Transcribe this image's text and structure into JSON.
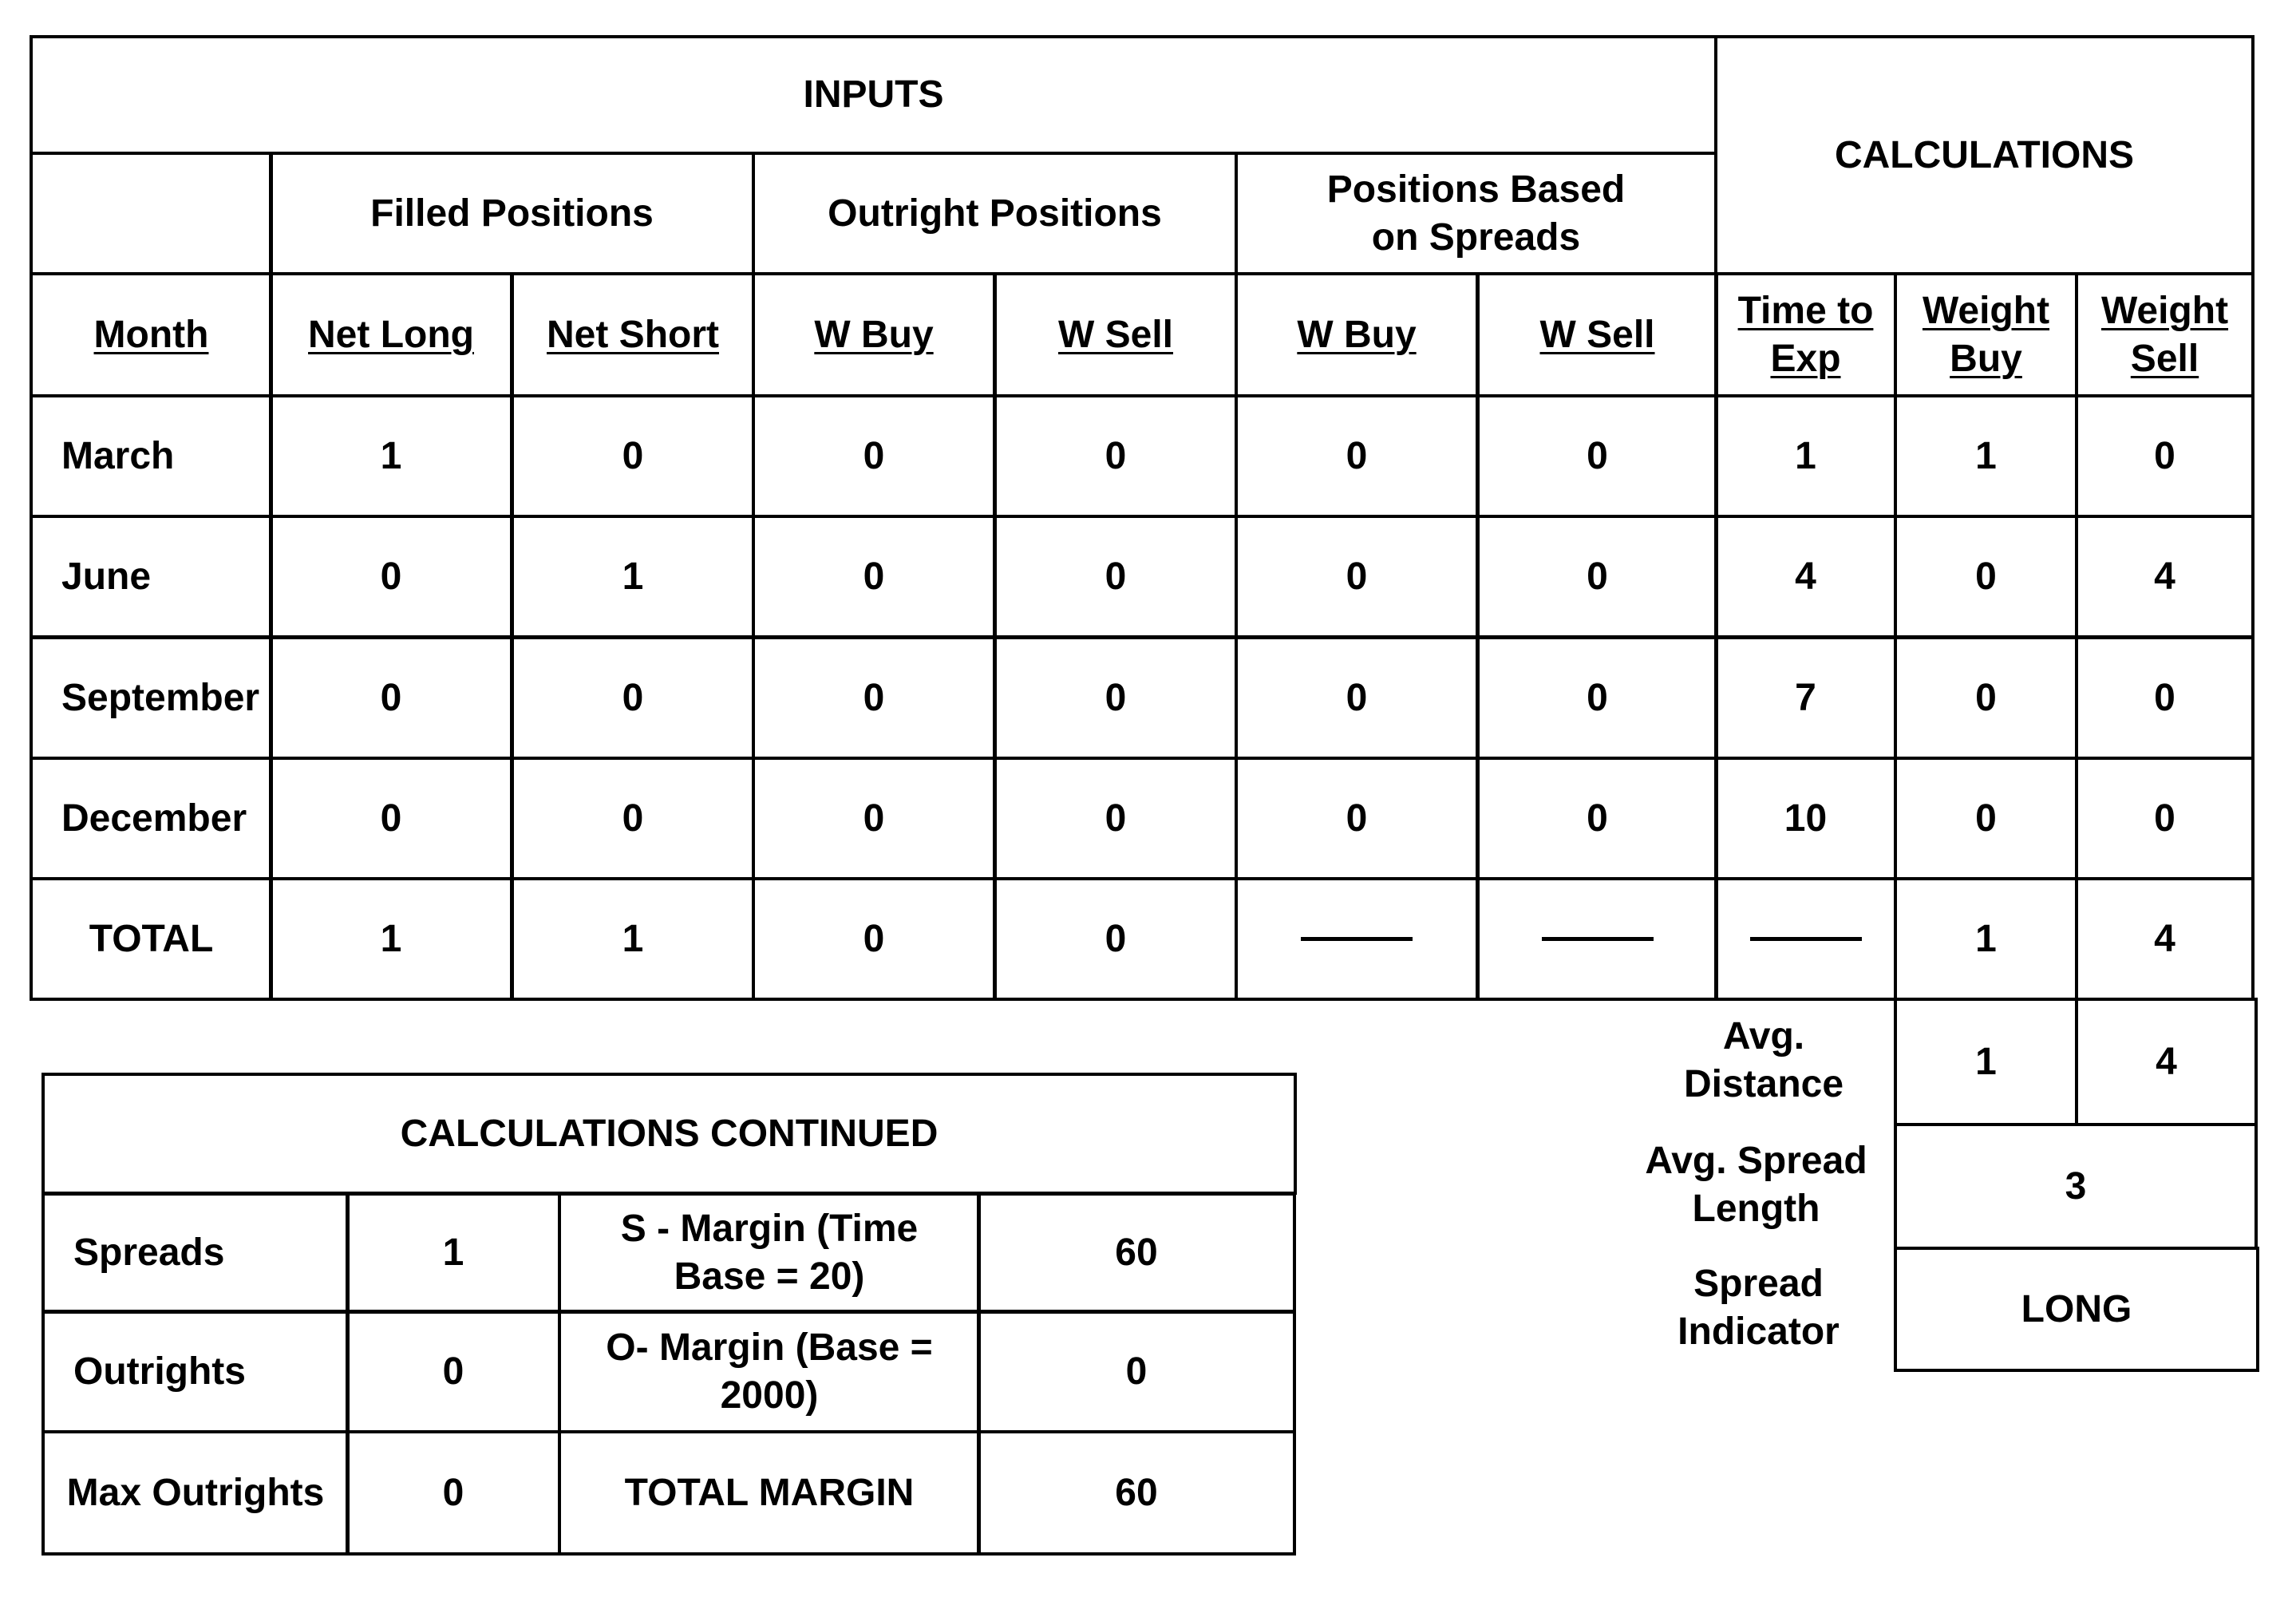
{
  "main_table": {
    "inputs_title": "INPUTS",
    "calculations_title": "CALCULATIONS",
    "groups": {
      "filled": "Filled Positions",
      "outright": "Outright Positions",
      "spreads": "Positions Based on Spreads"
    },
    "columns": [
      "Month",
      "Net Long",
      "Net Short",
      "W Buy",
      "W Sell",
      "W Buy",
      "W Sell",
      "Time to Exp",
      "Weight Buy",
      "Weight Sell"
    ],
    "rows": [
      {
        "month": "March",
        "values": [
          "1",
          "0",
          "0",
          "0",
          "0",
          "0",
          "1",
          "1",
          "0"
        ]
      },
      {
        "month": "June",
        "values": [
          "0",
          "1",
          "0",
          "0",
          "0",
          "0",
          "4",
          "0",
          "4"
        ]
      },
      {
        "month": "September",
        "values": [
          "0",
          "0",
          "0",
          "0",
          "0",
          "0",
          "7",
          "0",
          "0"
        ]
      },
      {
        "month": "December",
        "values": [
          "0",
          "0",
          "0",
          "0",
          "0",
          "0",
          "10",
          "0",
          "0"
        ]
      }
    ],
    "total": {
      "label": "TOTAL",
      "values": [
        "1",
        "1",
        "0",
        "0",
        "—",
        "—",
        "—",
        "1",
        "4"
      ]
    }
  },
  "summary": {
    "avg_distance": {
      "label": "Avg. Distance",
      "buy": "1",
      "sell": "4"
    },
    "avg_spread_length": {
      "label": "Avg. Spread Length",
      "value": "3"
    },
    "spread_indicator": {
      "label": "Spread Indicator",
      "value": "LONG"
    }
  },
  "calc_continued": {
    "title": "CALCULATIONS CONTINUED",
    "rows": [
      {
        "label": "Spreads",
        "count": "1",
        "margin_label": "S - Margin (Time Base = 20)",
        "margin_value": "60"
      },
      {
        "label": "Outrights",
        "count": "0",
        "margin_label": "O- Margin (Base = 2000)",
        "margin_value": "0"
      },
      {
        "label": "Max Outrights",
        "count": "0",
        "margin_label": "TOTAL MARGIN",
        "margin_value": "60"
      }
    ]
  }
}
